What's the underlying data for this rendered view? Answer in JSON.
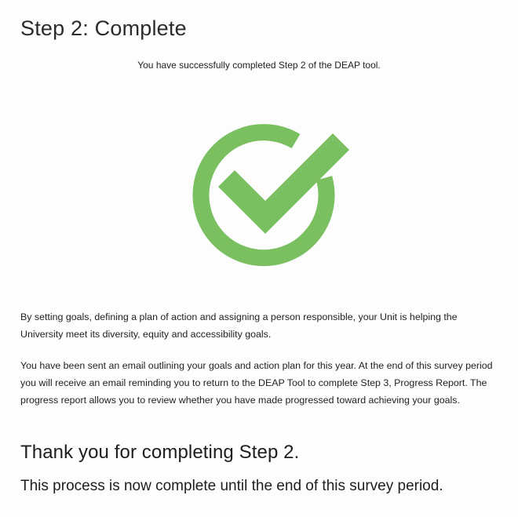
{
  "heading": {
    "title": "Step 2: Complete",
    "subtitle": "You have successfully completed Step 2 of the DEAP tool."
  },
  "icon": {
    "name": "check-circle-icon",
    "color": "#7abf60"
  },
  "body": {
    "paragraph_1": "By setting goals, defining a plan of action and assigning a person responsible, your Unit is helping the University meet its diversity, equity and accessibility goals.",
    "paragraph_2": "You have been sent an email outlining your goals and action plan for this year. At the end of this survey period you will receive an email reminding you to return to the DEAP Tool to complete Step 3, Progress Report. The progress report allows you to review whether you have made progressed toward achieving your goals."
  },
  "footer": {
    "thanks": "Thank you for completing Step 2.",
    "note": "This process is now complete until the end of this survey period."
  }
}
